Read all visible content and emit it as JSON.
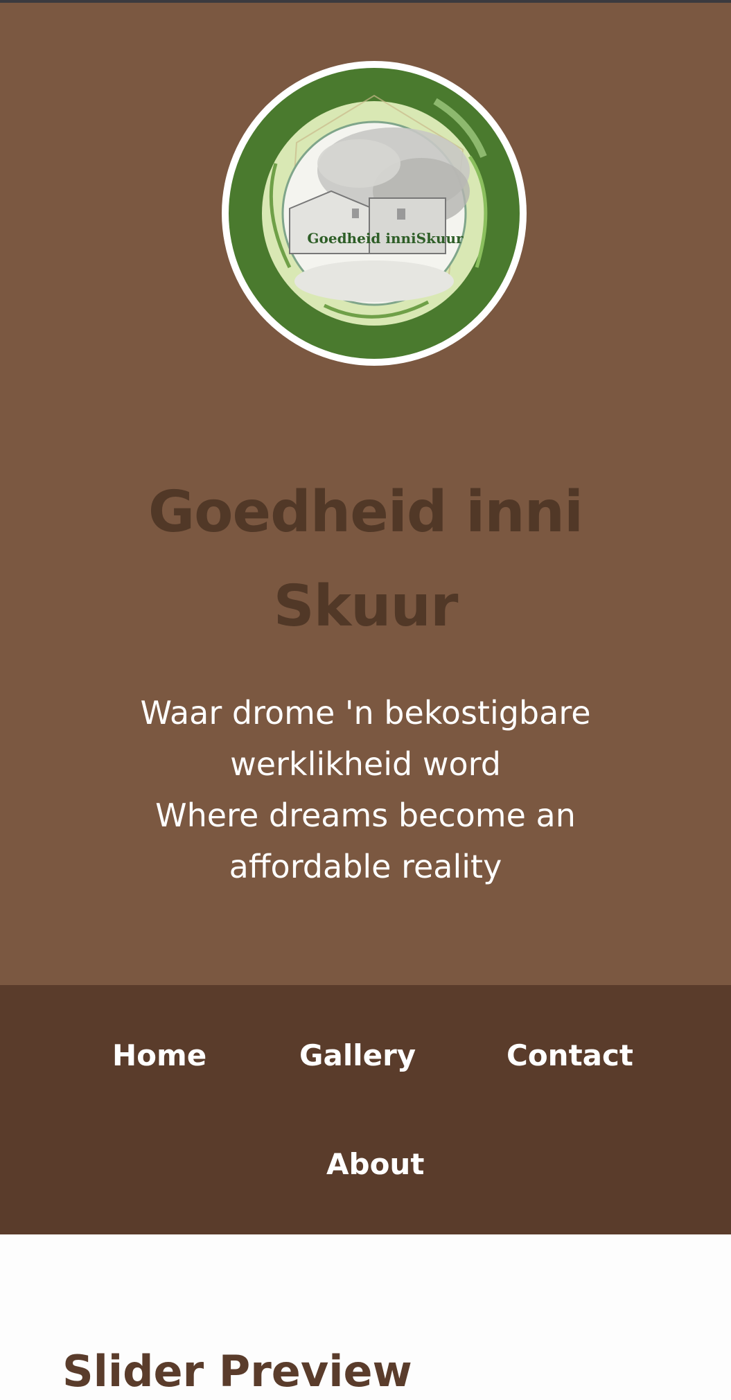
{
  "header": {
    "logo_text": "Goedheid inniSkuur",
    "site_title_line1": "Goedheid inni",
    "site_title_line2": "Skuur",
    "tagline_lines": [
      "Waar drome 'n bekostigbare",
      "werklikheid word",
      "Where dreams become an",
      "affordable reality"
    ]
  },
  "nav": {
    "items": [
      {
        "label": "Home"
      },
      {
        "label": "Gallery"
      },
      {
        "label": "Contact"
      },
      {
        "label": "About"
      }
    ]
  },
  "main": {
    "slider_heading": "Slider Preview"
  },
  "colors": {
    "hero_background": "#7b5841",
    "nav_background": "#5a3c2b",
    "title_color": "#513827",
    "logo_ring": "#4a7a2e",
    "logo_inner": "#d9e8b4"
  }
}
